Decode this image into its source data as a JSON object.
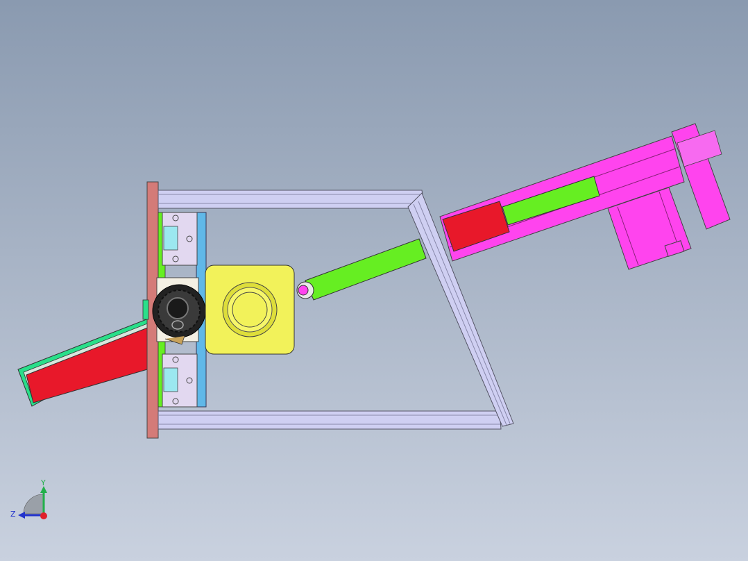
{
  "viewport": {
    "description_free": true
  },
  "triad": {
    "y_label": "Y",
    "z_label": "Z",
    "x_color": "#e0202a",
    "y_color": "#22b04a",
    "z_color": "#2233cc"
  },
  "colors": {
    "frame": "#cfcff2",
    "frame_edge": "#555566",
    "plate": "#d47b78",
    "rail": "#60b8e8",
    "block": "#e2d8f0",
    "cylinder_body": "#ff44ee",
    "piston_rod": "#66ee22",
    "barrel": "#e8182a",
    "pad": "#f2f25a",
    "knob": "#222222",
    "channel": "#2adf8a"
  }
}
